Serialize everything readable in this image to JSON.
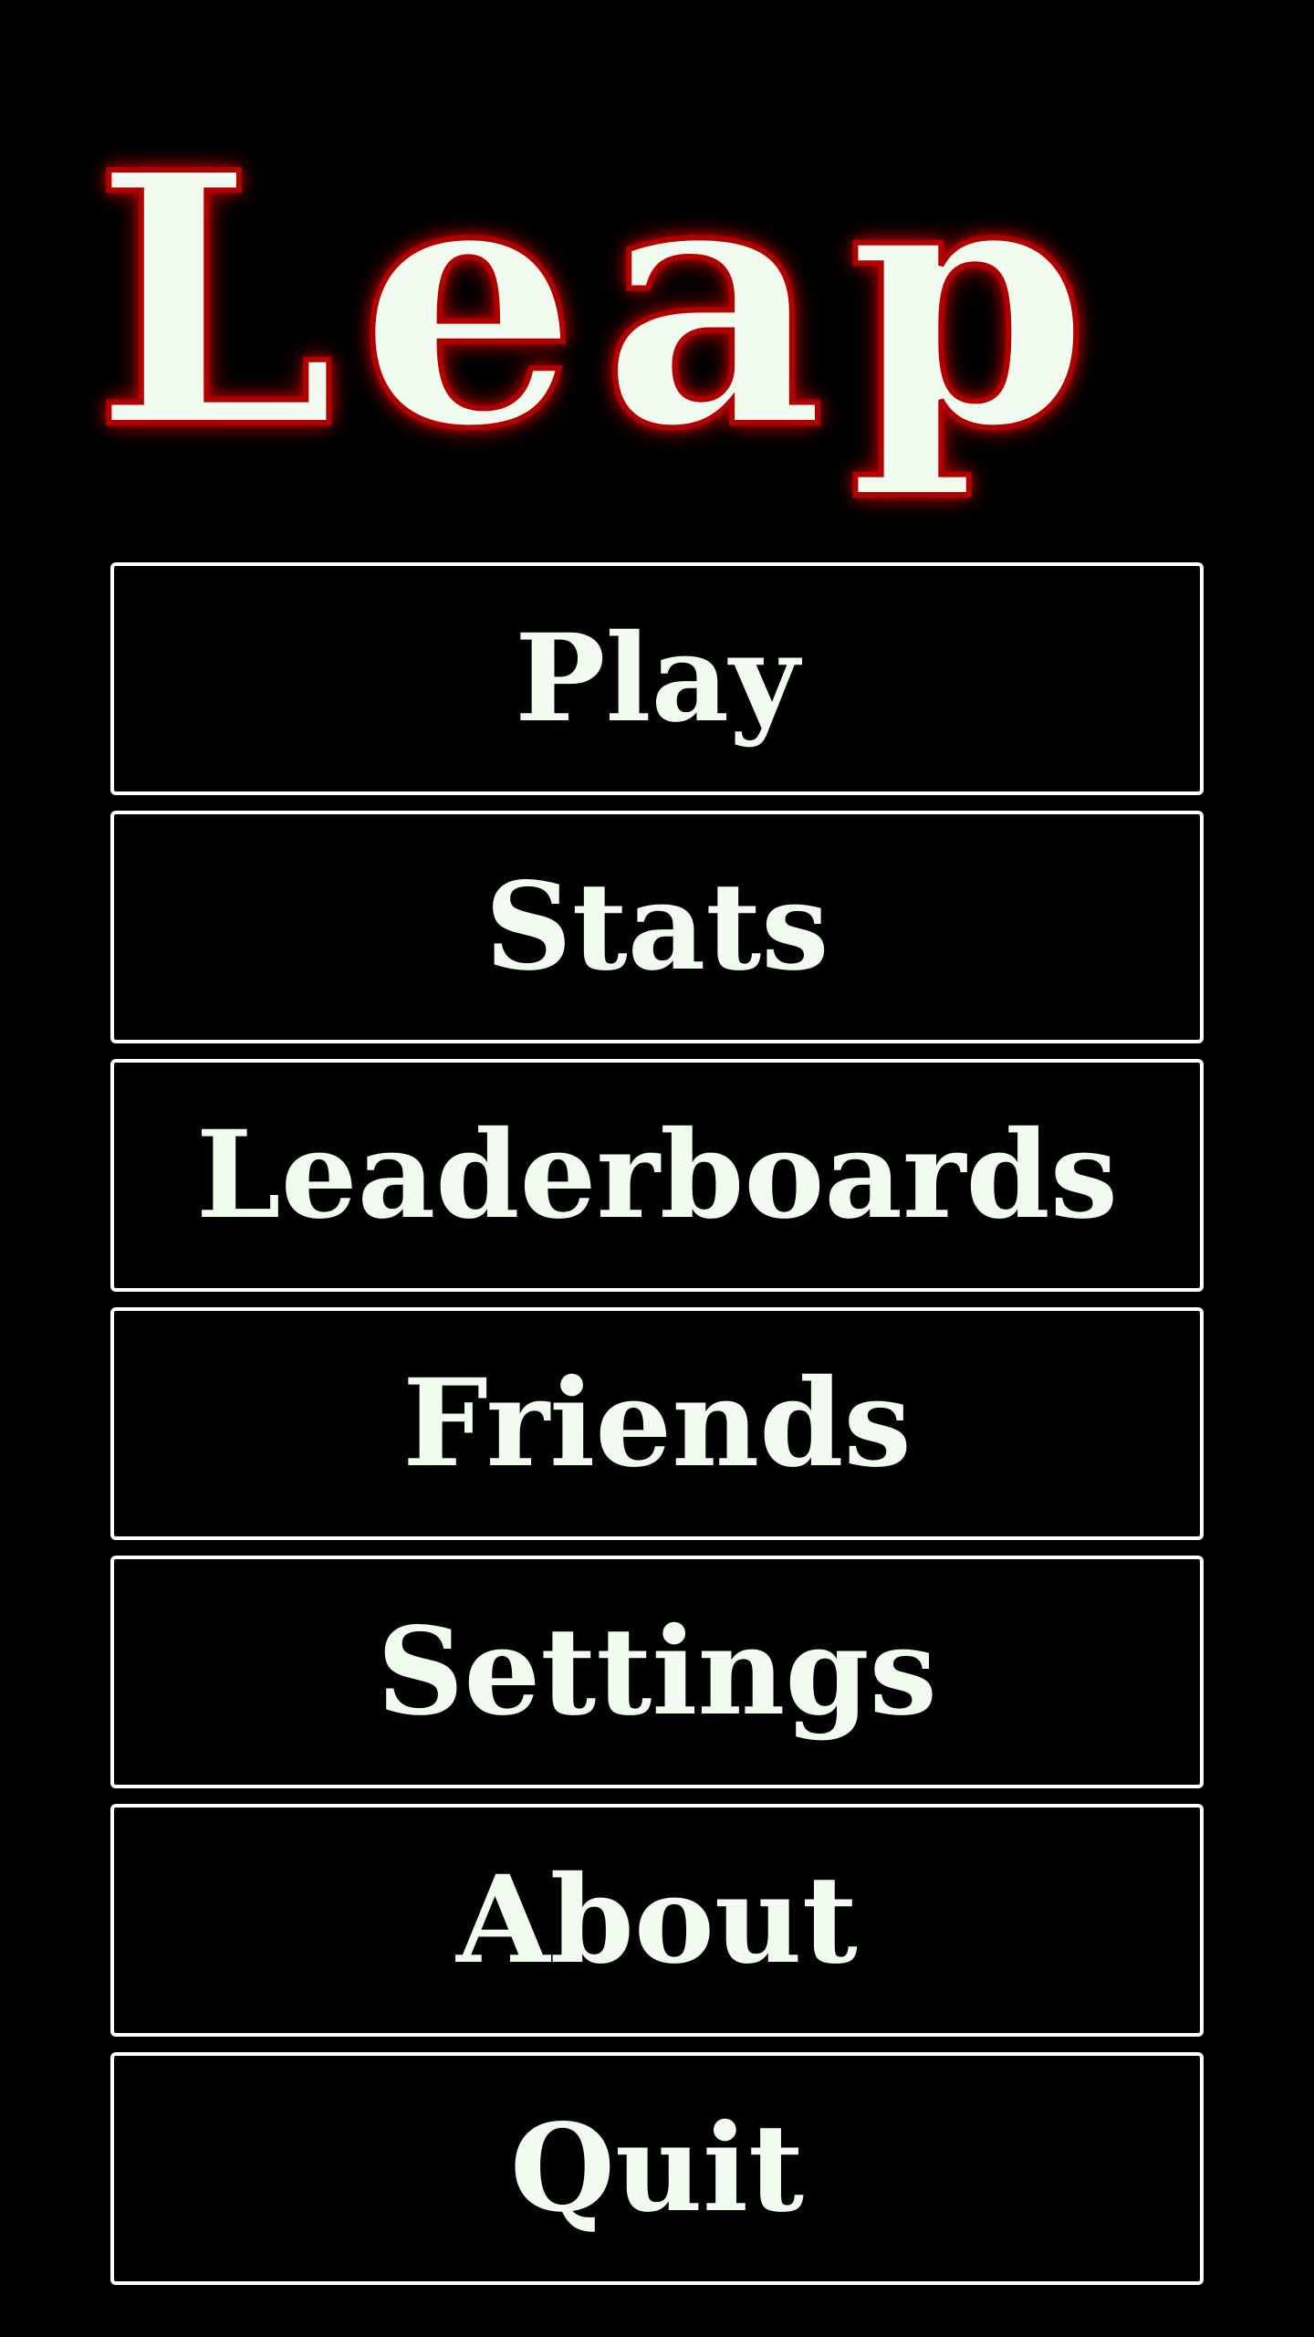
{
  "title": "Leap",
  "colors": {
    "background": "#000000",
    "text": "#f1fbef",
    "title_glow": "#b00000",
    "button_border": "#ffffff"
  },
  "menu": {
    "play": "Play",
    "stats": "Stats",
    "leaderboards": "Leaderboards",
    "friends": "Friends",
    "settings": "Settings",
    "about": "About",
    "quit": "Quit"
  }
}
